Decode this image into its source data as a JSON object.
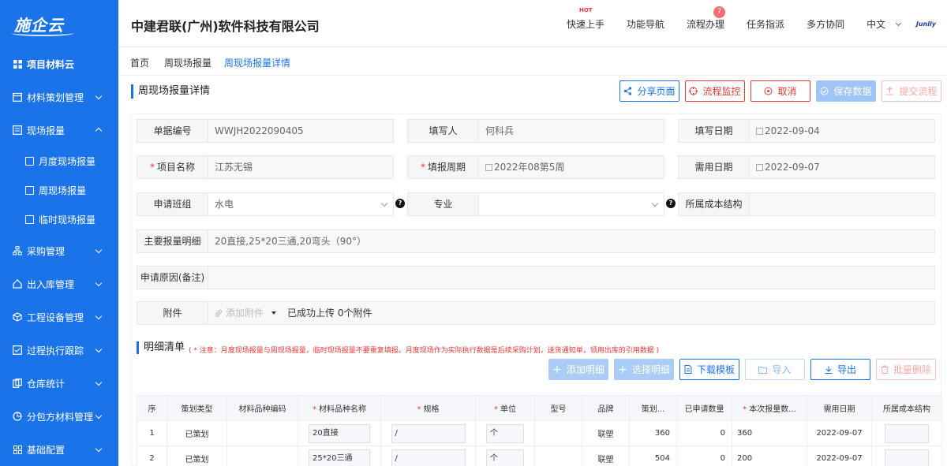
{
  "sidebar": {
    "logo": "施企云",
    "items": [
      {
        "label": "项目材料云",
        "icon": "grid-icon",
        "bold": true
      },
      {
        "label": "材料策划管理",
        "icon": "calendar-icon"
      },
      {
        "label": "现场报量",
        "icon": "list-icon",
        "expanded": true
      },
      {
        "label": "采购管理",
        "icon": "org-icon"
      },
      {
        "label": "出入库管理",
        "icon": "house-icon"
      },
      {
        "label": "工程设备管理",
        "icon": "box-icon"
      },
      {
        "label": "过程执行跟踪",
        "icon": "track-icon"
      },
      {
        "label": "仓库统计",
        "icon": "stats-icon"
      },
      {
        "label": "分包方材料管理",
        "icon": "pie-icon"
      },
      {
        "label": "基础配置",
        "icon": "grid-icon"
      }
    ],
    "subitems": [
      {
        "label": "月度现场报量"
      },
      {
        "label": "周现场报量"
      },
      {
        "label": "临时现场报量"
      }
    ]
  },
  "header": {
    "company": "中建君联(广州)软件科技有限公司",
    "nav": [
      {
        "label": "快速上手",
        "hot": "HOT"
      },
      {
        "label": "功能导航"
      },
      {
        "label": "流程办理",
        "badge": "7"
      },
      {
        "label": "任务指派"
      },
      {
        "label": "多方协同"
      },
      {
        "label": "中文"
      }
    ],
    "brand": "Junlly"
  },
  "tabs": [
    "首页",
    "周现场报量",
    "周现场报量详情"
  ],
  "page": {
    "title": "周现场报量详情",
    "buttons": {
      "share": "分享页面",
      "monitor": "流程监控",
      "cancel": "取消",
      "save": "保存数据",
      "submit": "提交流程"
    }
  },
  "form": {
    "doc_no": {
      "label": "单据编号",
      "value": "WWJH2022090405"
    },
    "writer": {
      "label": "填写人",
      "value": "何科兵"
    },
    "write_date": {
      "label": "填写日期",
      "value": "2022-09-04"
    },
    "project": {
      "label": "项目名称",
      "value": "江苏无锡"
    },
    "period": {
      "label": "填报周期",
      "value": "2022年08第5周"
    },
    "need_date": {
      "label": "需用日期",
      "value": "2022-09-07"
    },
    "team": {
      "label": "申请班组",
      "value": "水电"
    },
    "major": {
      "label": "专业",
      "value": ""
    },
    "cost": {
      "label": "所属成本结构",
      "value": ""
    },
    "detail": {
      "label": "主要报量明细",
      "value": "20直接,25*20三通,20弯头（90°）"
    },
    "reason": {
      "label": "申请原因(备注)",
      "value": ""
    },
    "attachment": {
      "label": "附件",
      "add": "添加附件",
      "status": "已成功上传 0个附件"
    }
  },
  "list": {
    "title": "明细清单",
    "note": "( * 注意：月度现场报量与周现场报量，临时现场报量不要重复填报。月度现场作为实际执行数据是后续采购计划，送货通知单，领用出库的引用数据 )",
    "buttons": {
      "add": "添加明细",
      "pick": "选择明细",
      "template": "下载模板",
      "import": "导入",
      "export": "导出",
      "batch_delete": "批量删除"
    },
    "columns": [
      "序",
      "策划类型",
      "材料品种编码",
      "材料品种名称",
      "规格",
      "单位",
      "型号",
      "品牌",
      "策划...",
      "已申请数量",
      "本次报量数...",
      "需用日期",
      "所属成本结构"
    ],
    "rows": [
      {
        "no": "1",
        "type": "已策划",
        "code": "",
        "name": "20直接",
        "spec": "/",
        "unit": "个",
        "model": "",
        "brand": "联塑",
        "plan": "360",
        "applied": "0",
        "qty": "360",
        "date": "2022-09-07",
        "cost": ""
      },
      {
        "no": "2",
        "type": "已策划",
        "code": "",
        "name": "25*20三通",
        "spec": "/",
        "unit": "个",
        "model": "",
        "brand": "联塑",
        "plan": "504",
        "applied": "0",
        "qty": "200",
        "date": "2022-09-07",
        "cost": ""
      }
    ]
  }
}
